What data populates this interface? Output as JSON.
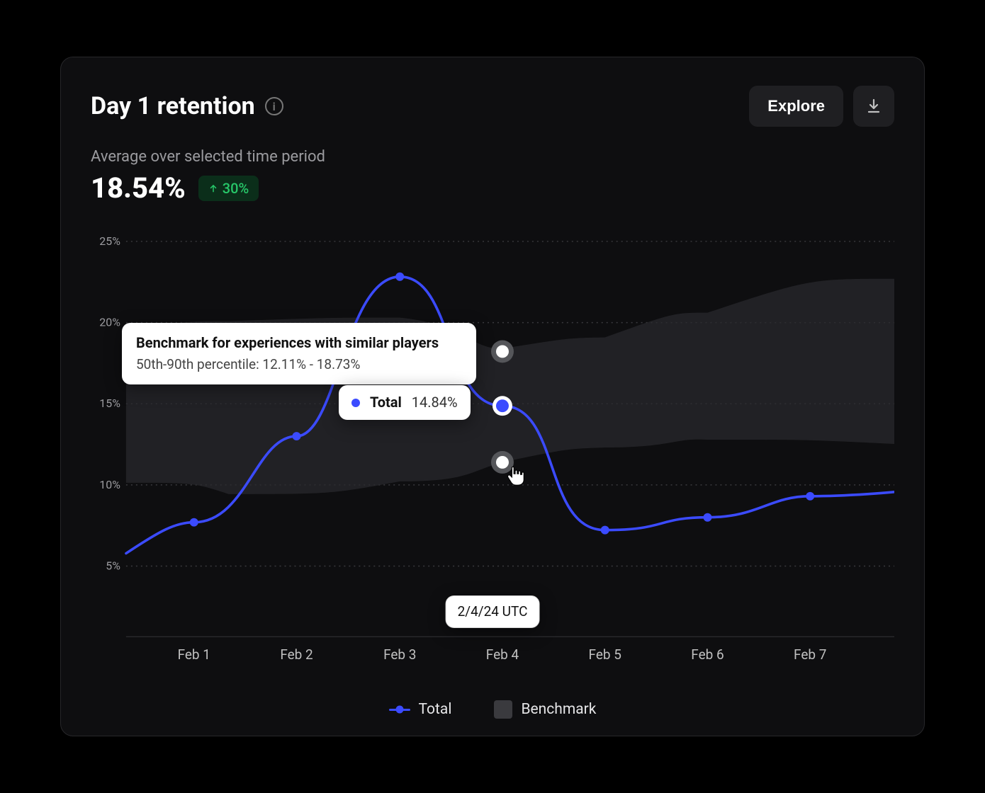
{
  "header": {
    "title": "Day 1 retention",
    "explore_label": "Explore"
  },
  "summary": {
    "subtitle": "Average over selected time period",
    "value": "18.54%",
    "delta": "30%"
  },
  "tooltip": {
    "bench_title": "Benchmark for experiences with similar players",
    "bench_sub": "50th-90th percentile: 12.11% - 18.73%",
    "total_label": "Total",
    "total_value": "14.84%",
    "date_label": "2/4/24 UTC"
  },
  "axis": {
    "y": [
      "5%",
      "10%",
      "15%",
      "20%",
      "25%"
    ],
    "x": [
      "Feb 1",
      "Feb 2",
      "Feb 3",
      "Feb 4",
      "Feb 5",
      "Feb 6",
      "Feb 7"
    ]
  },
  "legend": {
    "total": "Total",
    "benchmark": "Benchmark"
  },
  "chart_data": {
    "type": "line",
    "title": "Day 1 retention",
    "xlabel": "",
    "ylabel": "",
    "ylim": [
      5,
      25
    ],
    "categories": [
      "Feb 1",
      "Feb 2",
      "Feb 3",
      "Feb 4",
      "Feb 5",
      "Feb 6",
      "Feb 7"
    ],
    "series": [
      {
        "name": "Total",
        "values": [
          7.7,
          13.0,
          23.2,
          14.84,
          7.2,
          8.0,
          9.3
        ]
      }
    ],
    "benchmark_band": {
      "name": "Benchmark",
      "percentile": "50th-90th",
      "lower": [
        10.1,
        9.4,
        10.2,
        11.4,
        12.3,
        12.8,
        12.5
      ],
      "upper": [
        19.7,
        20.1,
        20.3,
        18.4,
        19.1,
        20.6,
        22.7
      ]
    },
    "highlight": {
      "category": "Feb 4",
      "total": 14.84,
      "benchmark_lower": 12.11,
      "benchmark_upper": 18.73
    }
  }
}
